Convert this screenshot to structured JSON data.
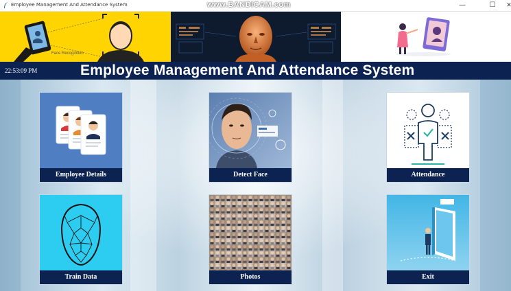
{
  "window": {
    "title": "Employee Management And Attendance System",
    "watermark": "www.BANDICAM.com",
    "minimize_glyph": "—",
    "maximize_glyph": "☐",
    "close_glyph": "✕",
    "app_icon": "feather-icon"
  },
  "header": {
    "clock": "22:53:09 PM",
    "title": "Employee Management And Attendance System",
    "banners": [
      "face-recognition-banner",
      "3d-face-scan-banner",
      "video-call-banner"
    ],
    "banner_caption": "Face Recognition"
  },
  "tiles": [
    {
      "label": "Employee Details",
      "icon": "id-cards-icon"
    },
    {
      "label": "Detect Face",
      "icon": "face-scan-icon"
    },
    {
      "label": "Attendance",
      "icon": "attendance-people-icon"
    },
    {
      "label": "Train Data",
      "icon": "face-mesh-icon"
    },
    {
      "label": "Photos",
      "icon": "photo-grid-icon"
    },
    {
      "label": "Exit",
      "icon": "exit-door-icon"
    }
  ],
  "colors": {
    "title_strip": "#0c2352",
    "banner_yellow": "#ffd400",
    "tile_label_bg": "#0c2352"
  }
}
